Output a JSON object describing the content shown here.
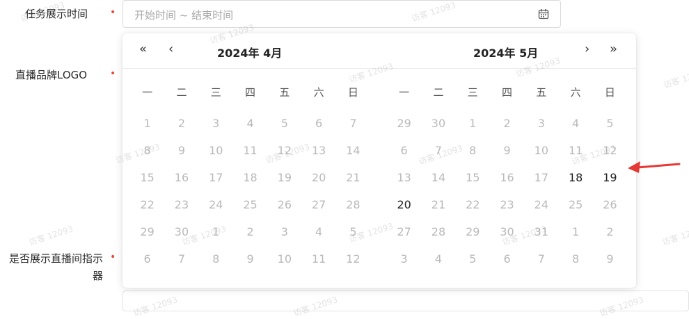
{
  "form": {
    "task_time_label": "任务展示时间",
    "logo_label": "直播品牌LOGO",
    "indicator_label_line1": "是否展示直播间指示",
    "indicator_label_line2": "器",
    "required_mark": "•"
  },
  "date_input": {
    "placeholder": "开始时间 ~ 结束时间",
    "icon": "calendar-icon"
  },
  "picker": {
    "nav": {
      "prev_year": "«",
      "prev_month": "‹",
      "next_month": "›",
      "next_year": "»"
    },
    "weekdays": [
      "一",
      "二",
      "三",
      "四",
      "五",
      "六",
      "日"
    ],
    "left": {
      "title": "2024年 4月",
      "weeks": [
        [
          "1",
          "2",
          "3",
          "4",
          "5",
          "6",
          "7"
        ],
        [
          "8",
          "9",
          "10",
          "11",
          "12",
          "13",
          "14"
        ],
        [
          "15",
          "16",
          "17",
          "18",
          "19",
          "20",
          "21"
        ],
        [
          "22",
          "23",
          "24",
          "25",
          "26",
          "27",
          "28"
        ],
        [
          "29",
          "30",
          "1",
          "2",
          "3",
          "4",
          "5"
        ],
        [
          "6",
          "7",
          "8",
          "9",
          "10",
          "11",
          "12"
        ]
      ]
    },
    "right": {
      "title": "2024年 5月",
      "weeks": [
        [
          "29",
          "30",
          "1",
          "2",
          "3",
          "4",
          "5"
        ],
        [
          "6",
          "7",
          "8",
          "9",
          "10",
          "11",
          "12"
        ],
        [
          "13",
          "14",
          "15",
          "16",
          "17",
          "18",
          "19"
        ],
        [
          "20",
          "21",
          "22",
          "23",
          "24",
          "25",
          "26"
        ],
        [
          "27",
          "28",
          "29",
          "30",
          "31",
          "1",
          "2"
        ],
        [
          "3",
          "4",
          "5",
          "6",
          "7",
          "8",
          "9"
        ]
      ],
      "enabled_days": [
        "18",
        "19",
        "20"
      ]
    }
  },
  "watermark_text": "访客 12093",
  "colors": {
    "required": "#e8453c",
    "disabled_day": "#b9b9b9",
    "active_day": "#222222",
    "annotation_arrow": "#e53935"
  }
}
